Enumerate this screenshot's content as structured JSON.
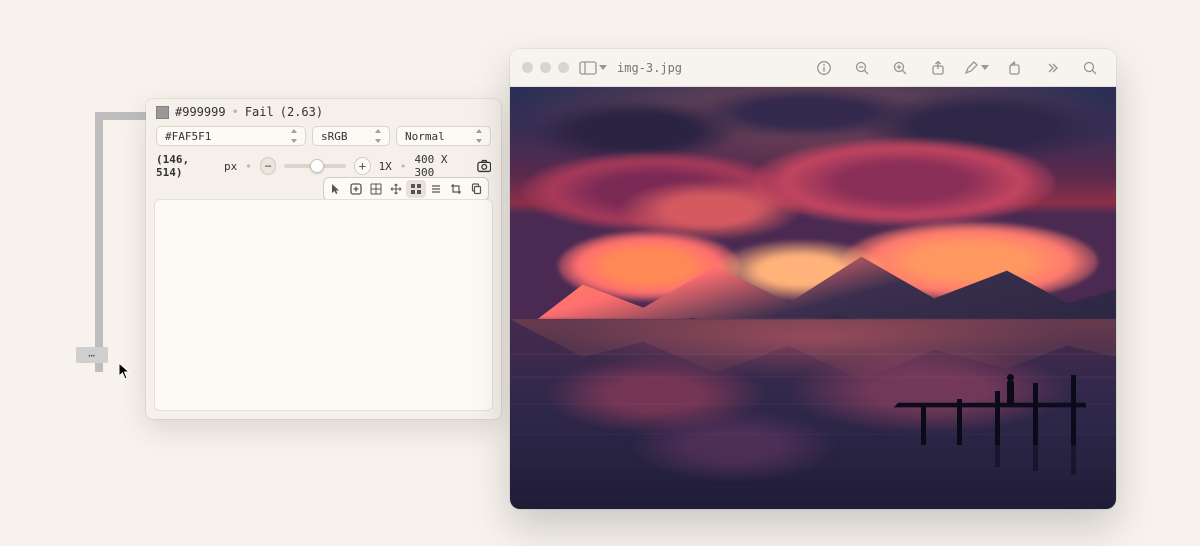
{
  "picker": {
    "sampled_hex": "#999999",
    "contrast_status": "Fail",
    "contrast_ratio": "(2.63)",
    "color_field": "#FAF5F1",
    "color_space": "sRGB",
    "blend_mode": "Normal",
    "coords": "(146, 514)",
    "coords_unit": "px",
    "zoom_label": "1X",
    "dimensions": "400 X 300"
  },
  "preview": {
    "filename": "img-3.jpg"
  }
}
